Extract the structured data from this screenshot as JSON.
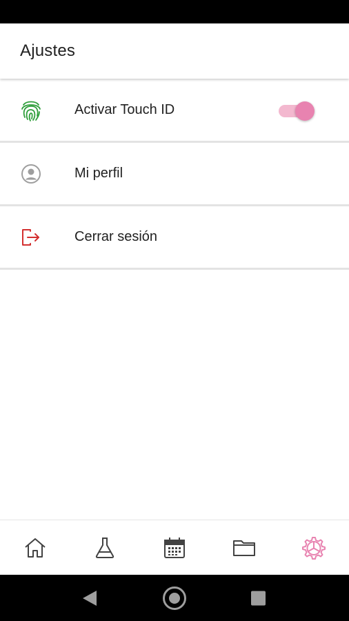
{
  "app_bar": {
    "title": "Ajustes"
  },
  "settings": [
    {
      "label": "Activar Touch ID",
      "icon": "fingerprint-icon",
      "icon_color": "#2e9e3a",
      "toggle_on": true
    },
    {
      "label": "Mi perfil",
      "icon": "account-circle-icon",
      "icon_color": "#9e9e9e"
    },
    {
      "label": "Cerrar sesión",
      "icon": "logout-icon",
      "icon_color": "#d32f2f"
    }
  ],
  "bottom_nav": [
    {
      "icon": "home-icon",
      "active": false
    },
    {
      "icon": "flask-icon",
      "active": false
    },
    {
      "icon": "calendar-icon",
      "active": false
    },
    {
      "icon": "folder-icon",
      "active": false
    },
    {
      "icon": "settings-icon",
      "active": true
    }
  ],
  "colors": {
    "accent": "#e883b0",
    "accent_track": "#f3b8cf",
    "inactive_icon": "#424242"
  }
}
